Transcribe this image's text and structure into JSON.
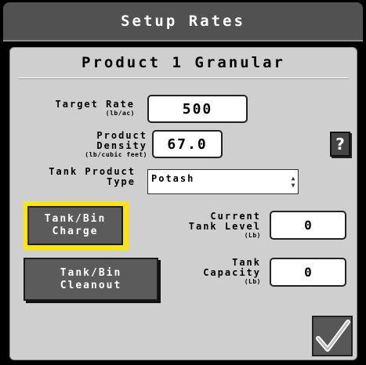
{
  "window": {
    "title": "Setup Rates"
  },
  "product": {
    "title": "Product 1 Granular"
  },
  "target_rate": {
    "label": "Target Rate",
    "unit": "(lb/ac)",
    "value": "500"
  },
  "product_density": {
    "label_line1": "Product",
    "label_line2": "Density",
    "unit": "(lb/cubic feet)",
    "value": "67.0"
  },
  "tank_product_type": {
    "label_line1": "Tank Product",
    "label_line2": "Type",
    "value": "Potash"
  },
  "help": {
    "label": "?"
  },
  "tank_bin_charge": {
    "line1": "Tank/Bin",
    "line2": "Charge"
  },
  "tank_bin_cleanout": {
    "line1": "Tank/Bin",
    "line2": "Cleanout"
  },
  "current_tank_level": {
    "label_line1": "Current",
    "label_line2": "Tank Level",
    "unit": "(Lb)",
    "value": "0"
  },
  "tank_capacity": {
    "label_line1": "Tank",
    "label_line2": "Capacity",
    "unit": "(Lb)",
    "value": "0"
  },
  "icons": {
    "accept": "checkmark-icon",
    "select_arrows": "up-down-arrows-icon"
  },
  "colors": {
    "highlight": "#ffe600",
    "panel": "#cfcfcf",
    "titlebar": "#515151"
  }
}
